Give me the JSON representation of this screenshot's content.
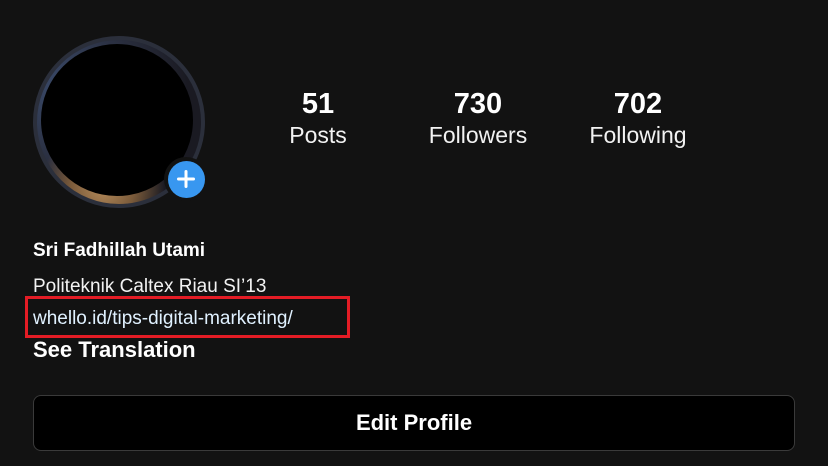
{
  "profile": {
    "name": "Sri Fadhillah Utami",
    "bio": "Politeknik Caltex Riau SI’13",
    "link": "whello.id/tips-digital-marketing/",
    "see_translation": "See Translation",
    "add_icon": "plus-icon",
    "highlight_color": "#e31c25",
    "accent_color": "#3897f0"
  },
  "stats": {
    "posts": {
      "value": "51",
      "label": "Posts"
    },
    "followers": {
      "value": "730",
      "label": "Followers"
    },
    "following": {
      "value": "702",
      "label": "Following"
    }
  },
  "actions": {
    "edit_profile": "Edit Profile"
  }
}
